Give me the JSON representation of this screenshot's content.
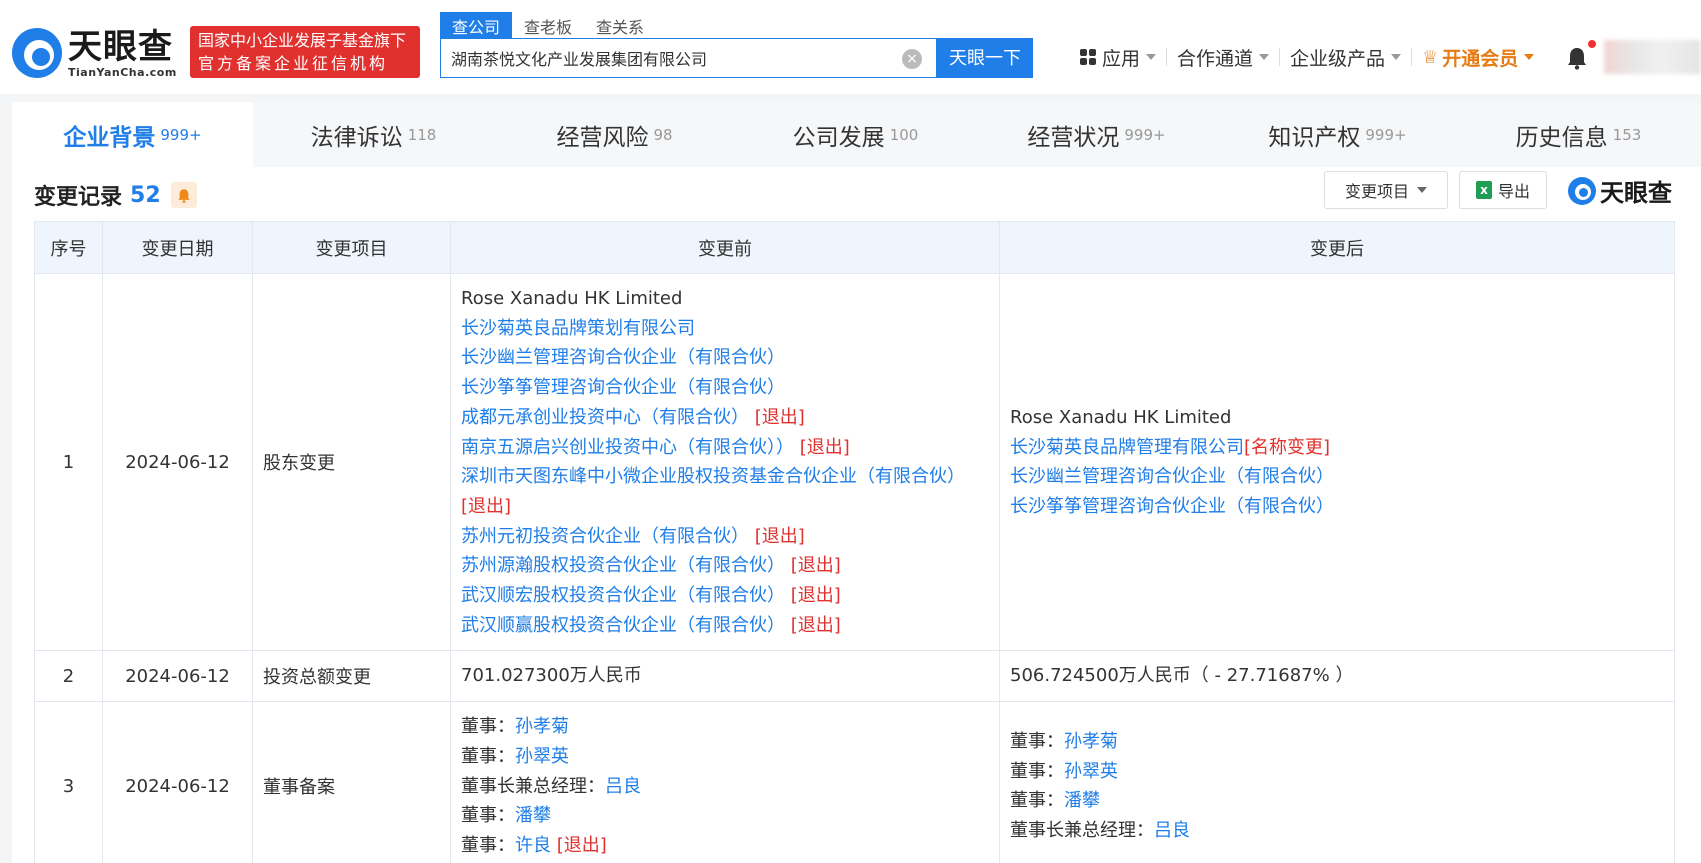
{
  "header": {
    "logo": {
      "cn": "天眼查",
      "en": "TianYanCha.com"
    },
    "badge_lines": [
      "国家中小企业发展子基金旗下",
      "官方备案企业征信机构"
    ],
    "search_tabs": [
      "查公司",
      "查老板",
      "查关系"
    ],
    "search_value": "湖南茶悦文化产业发展集团有限公司",
    "search_button": "天眼一下",
    "nav": {
      "apps": "应用",
      "partners": "合作通道",
      "enterprise": "企业级产品",
      "vip": "开通会员"
    }
  },
  "subtabs": [
    {
      "label": "企业背景",
      "count": "999+"
    },
    {
      "label": "法律诉讼",
      "count": "118"
    },
    {
      "label": "经营风险",
      "count": "98"
    },
    {
      "label": "公司发展",
      "count": "100"
    },
    {
      "label": "经营状况",
      "count": "999+"
    },
    {
      "label": "知识产权",
      "count": "999+"
    },
    {
      "label": "历史信息",
      "count": "153"
    }
  ],
  "section": {
    "title": "变更记录",
    "count": "52",
    "filter_label": "变更项目",
    "export_label": "导出",
    "watermark": "天眼查"
  },
  "table": {
    "headers": [
      "序号",
      "变更日期",
      "变更项目",
      "变更前",
      "变更后"
    ],
    "rows": [
      {
        "idx": "1",
        "date": "2024-06-12",
        "item": "股东变更",
        "before": [
          {
            "text": "Rose Xanadu HK Limited",
            "tag": ""
          },
          {
            "text": "长沙菊英良品牌策划有限公司",
            "tag": ""
          },
          {
            "text": "长沙幽兰管理咨询合伙企业（有限合伙）",
            "tag": ""
          },
          {
            "text": "长沙筝筝管理咨询合伙企业（有限合伙）",
            "tag": ""
          },
          {
            "text": "成都元承创业投资中心（有限合伙）",
            "tag": "[退出]"
          },
          {
            "text": "南京五源启兴创业投资中心（有限合伙））",
            "tag": "[退出]"
          },
          {
            "text": "深圳市天图东峰中小微企业股权投资基金合伙企业（有限合伙）",
            "tag": "[退出]"
          },
          {
            "text": "苏州元初投资合伙企业（有限合伙）",
            "tag": "[退出]"
          },
          {
            "text": "苏州源瀚股权投资合伙企业（有限合伙）",
            "tag": "[退出]"
          },
          {
            "text": "武汉顺宏股权投资合伙企业（有限合伙）",
            "tag": "[退出]"
          },
          {
            "text": "武汉顺赢股权投资合伙企业（有限合伙）",
            "tag": "[退出]"
          }
        ],
        "after": [
          {
            "text": "Rose Xanadu HK Limited",
            "tag": ""
          },
          {
            "text": "长沙菊英良品牌管理有限公司",
            "tag": "[名称变更]"
          },
          {
            "text": "长沙幽兰管理咨询合伙企业（有限合伙）",
            "tag": ""
          },
          {
            "text": "长沙筝筝管理咨询合伙企业（有限合伙）",
            "tag": ""
          }
        ]
      },
      {
        "idx": "2",
        "date": "2024-06-12",
        "item": "投资总额变更",
        "before_text": "701.027300万人民币",
        "after_text": "506.724500万人民币（ - 27.71687% ）"
      },
      {
        "idx": "3",
        "date": "2024-06-12",
        "item": "董事备案",
        "before": [
          {
            "role": "董事：",
            "name": "孙孝菊",
            "tag": ""
          },
          {
            "role": "董事：",
            "name": "孙翠英",
            "tag": ""
          },
          {
            "role": "董事长兼总经理：",
            "name": "吕良",
            "tag": ""
          },
          {
            "role": "董事：",
            "name": "潘攀",
            "tag": ""
          },
          {
            "role": "董事：",
            "name": "许良",
            "tag": "[退出]"
          }
        ],
        "after": [
          {
            "role": "董事：",
            "name": "孙孝菊",
            "tag": ""
          },
          {
            "role": "董事：",
            "name": "孙翠英",
            "tag": ""
          },
          {
            "role": "董事：",
            "name": "潘攀",
            "tag": ""
          },
          {
            "role": "董事长兼总经理：",
            "name": "吕良",
            "tag": ""
          }
        ]
      }
    ]
  },
  "colors": {
    "brand": "#1f7ee8",
    "exit": "#e0312f",
    "vip": "#e57b12",
    "decrease": "#1aad19"
  }
}
